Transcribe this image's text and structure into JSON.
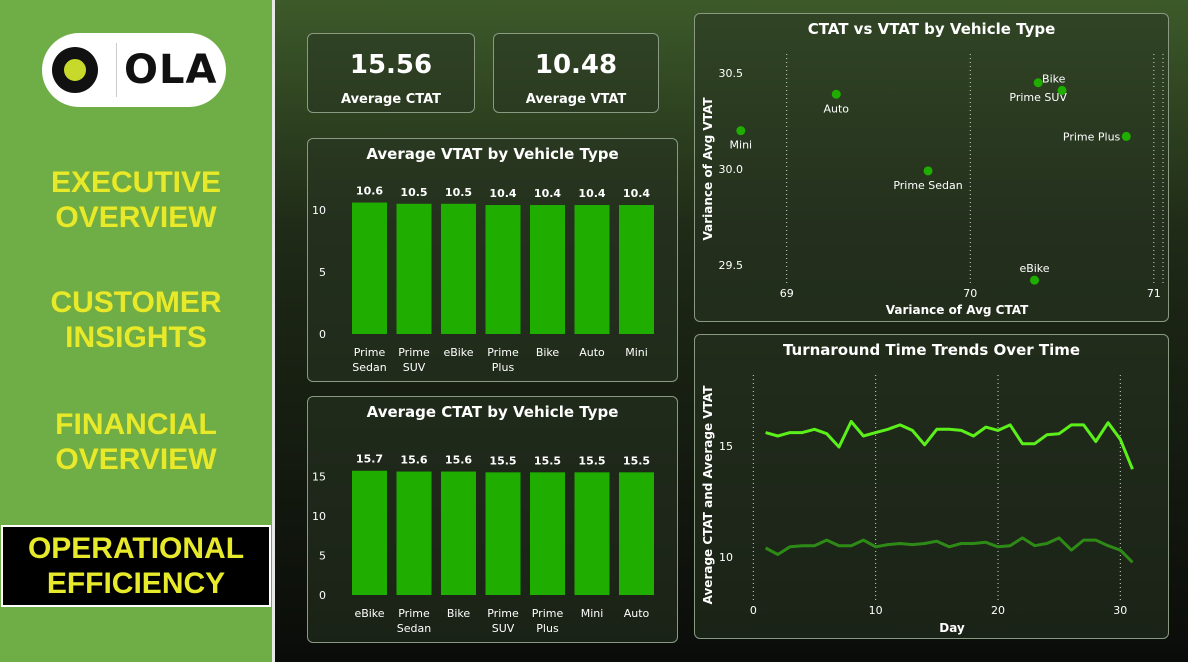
{
  "brand": {
    "name": "OLA"
  },
  "nav": {
    "executive": "EXECUTIVE\nOVERVIEW",
    "customer": "CUSTOMER\nINSIGHTS",
    "financial": "FINANCIAL\nOVERVIEW",
    "operational": "OPERATIONAL\nEFFICIENCY"
  },
  "kpis": [
    {
      "value": "15.56",
      "label": "Average CTAT"
    },
    {
      "value": "10.48",
      "label": "Average VTAT"
    }
  ],
  "colors": {
    "bar": "#1fae00",
    "line_ctat": "#5cf01a",
    "line_vtat": "#2e8a16",
    "nav_text": "#e7ea2a",
    "sidebar": "#6fae47"
  },
  "chart_data": [
    {
      "id": "vtat_bar",
      "type": "bar",
      "title": "Average VTAT by Vehicle Type",
      "categories": [
        "Prime Sedan",
        "Prime SUV",
        "eBike",
        "Prime Plus",
        "Bike",
        "Auto",
        "Mini"
      ],
      "values": [
        10.6,
        10.5,
        10.5,
        10.4,
        10.4,
        10.4,
        10.4
      ],
      "value_labels": [
        "10.6",
        "10.5",
        "10.5",
        "10.4",
        "10.4",
        "10.4",
        "10.4"
      ],
      "yticks": [
        "0",
        "5",
        "10"
      ],
      "ylim": [
        0,
        12.5
      ]
    },
    {
      "id": "ctat_bar",
      "type": "bar",
      "title": "Average CTAT by Vehicle Type",
      "categories": [
        "eBike",
        "Prime Sedan",
        "Bike",
        "Prime SUV",
        "Prime Plus",
        "Mini",
        "Auto"
      ],
      "values": [
        15.7,
        15.6,
        15.6,
        15.5,
        15.5,
        15.5,
        15.5
      ],
      "value_labels": [
        "15.7",
        "15.6",
        "15.6",
        "15.5",
        "15.5",
        "15.5",
        "15.5"
      ],
      "yticks": [
        "0",
        "5",
        "10",
        "15"
      ],
      "ylim": [
        0,
        18.7
      ]
    },
    {
      "id": "scatter",
      "type": "scatter",
      "title": "CTAT vs VTAT by Vehicle Type",
      "xlabel": "Variance of Avg CTAT",
      "ylabel": "Variance of Avg VTAT",
      "xticks": [
        "69",
        "70",
        "71"
      ],
      "yticks": [
        "29.5",
        "30.0",
        "30.5"
      ],
      "xlim": [
        68.8,
        71.05
      ],
      "ylim": [
        29.4,
        30.6
      ],
      "points": [
        {
          "label": "Mini",
          "x": 68.75,
          "y": 30.2
        },
        {
          "label": "Auto",
          "x": 69.27,
          "y": 30.39
        },
        {
          "label": "Prime Sedan",
          "x": 69.77,
          "y": 29.99
        },
        {
          "label": "Prime SUV",
          "x": 70.37,
          "y": 30.45
        },
        {
          "label": "Bike",
          "x": 70.5,
          "y": 30.41
        },
        {
          "label": "Prime Plus",
          "x": 70.85,
          "y": 30.17
        },
        {
          "label": "eBike",
          "x": 70.35,
          "y": 29.42
        }
      ]
    },
    {
      "id": "trend",
      "type": "line",
      "title": "Turnaround Time Trends Over Time",
      "xlabel": "Day",
      "ylabel": "Average CTAT and Average VTAT",
      "xticks": [
        "0",
        "10",
        "20",
        "30"
      ],
      "yticks": [
        "10",
        "15"
      ],
      "xlim": [
        -1.5,
        33
      ],
      "ylim": [
        8.5,
        18.2
      ],
      "x": [
        1,
        2,
        3,
        4,
        5,
        6,
        7,
        8,
        9,
        10,
        11,
        12,
        13,
        14,
        15,
        16,
        17,
        18,
        19,
        20,
        21,
        22,
        23,
        24,
        25,
        26,
        27,
        28,
        29,
        30,
        31
      ],
      "series": [
        {
          "key": "ctat",
          "values": [
            15.6,
            15.45,
            15.6,
            15.6,
            15.75,
            15.55,
            14.95,
            16.1,
            15.45,
            15.6,
            15.75,
            15.95,
            15.7,
            15.05,
            15.75,
            15.75,
            15.7,
            15.45,
            15.85,
            15.7,
            15.95,
            15.1,
            15.1,
            15.5,
            15.55,
            15.95,
            15.95,
            15.2,
            16.05,
            15.3,
            13.95
          ]
        },
        {
          "key": "vtat",
          "values": [
            10.4,
            10.1,
            10.45,
            10.5,
            10.5,
            10.75,
            10.5,
            10.5,
            10.75,
            10.45,
            10.55,
            10.6,
            10.55,
            10.6,
            10.7,
            10.45,
            10.6,
            10.6,
            10.65,
            10.45,
            10.5,
            10.85,
            10.5,
            10.6,
            10.85,
            10.3,
            10.75,
            10.75,
            10.5,
            10.3,
            9.75
          ]
        }
      ]
    }
  ]
}
